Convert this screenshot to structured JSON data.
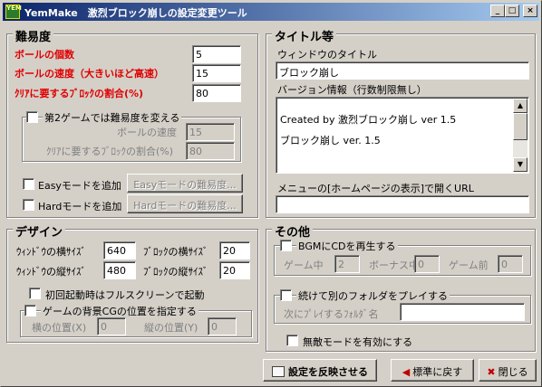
{
  "window": {
    "title": "YemMake　激烈ブロック崩しの設定変更ツール",
    "icon_text": "YEM",
    "controls": {
      "minimize": "_",
      "maximize": "□",
      "close": "×"
    }
  },
  "difficulty": {
    "title": "難易度",
    "ball_count": {
      "label": "ボールの個数",
      "value": "5"
    },
    "ball_speed": {
      "label": "ボールの速度（大きいほど高速）",
      "value": "15"
    },
    "clear_ratio": {
      "label": "ｸﾘｱに要するﾌﾞﾛｯｸの割合(%)",
      "value": "80"
    },
    "game2": {
      "checkbox_label": "第2ゲームでは難易度を変える",
      "speed_label": "ボールの速度",
      "speed_value": "15",
      "ratio_label": "ｸﾘｱに要するﾌﾞﾛｯｸの割合(%)",
      "ratio_value": "80"
    },
    "easy": {
      "checkbox_label": "Easyモードを追加",
      "button": "Easyモードの難易度..."
    },
    "hard": {
      "checkbox_label": "Hardモードを追加",
      "button": "Hardモードの難易度..."
    }
  },
  "titles": {
    "title": "タイトル等",
    "window_title_label": "ウィンドウのタイトル",
    "window_title_value": "ブロック崩し",
    "version_label": "バージョン情報（行数制限無し）",
    "version_line1": "Created by 激烈ブロック崩し ver 1.5",
    "version_line2": "ブロック崩し ver. 1.5",
    "url_label": "メニューの[ホームページの表示]で開くURL",
    "url_value": ""
  },
  "design": {
    "title": "デザイン",
    "win_width_label": "ｳｨﾝﾄﾞｳの横ｻｲｽﾞ",
    "win_width_value": "640",
    "win_height_label": "ｳｨﾝﾄﾞｳの縦ｻｲｽﾞ",
    "win_height_value": "480",
    "block_width_label": "ﾌﾞﾛｯｸの横ｻｲｽﾞ",
    "block_width_value": "20",
    "block_height_label": "ﾌﾞﾛｯｸの縦ｻｲｽﾞ",
    "block_height_value": "20",
    "fullscreen_label": "初回起動時はフルスクリーンで起動",
    "bg_label": "ゲームの背景CGの位置を指定する",
    "bg_x_label": "横の位置(X)",
    "bg_x_value": "0",
    "bg_y_label": "縦の位置(Y)",
    "bg_y_value": "0"
  },
  "other": {
    "title": "その他",
    "bgm_label": "BGMにCDを再生する",
    "game_label": "ゲーム中",
    "game_value": "2",
    "bonus_label": "ボーナス中",
    "bonus_value": "0",
    "pregame_label": "ゲーム前",
    "pregame_value": "0",
    "folder_label": "続けて別のフォルダをプレイする",
    "next_folder_label": "次にﾌﾟﾚｲするﾌｫﾙﾀﾞ名",
    "next_folder_value": "",
    "invincible_label": "無敵モードを有効にする"
  },
  "buttons": {
    "apply": "設定を反映させる",
    "reset": "標準に戻す",
    "close": "閉じる"
  },
  "colors": {
    "titlebar_start": "#0a246a",
    "titlebar_end": "#a6caf0",
    "required_label": "#e00000"
  }
}
